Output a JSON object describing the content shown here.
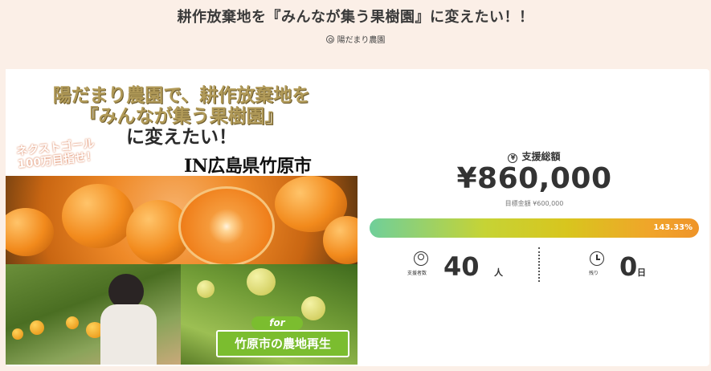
{
  "project": {
    "title": "耕作放棄地を『みんなが集う果樹園』に変えたい！！",
    "owner": "陽だまり農園"
  },
  "hero": {
    "headline_line1": "陽だまり農園で、耕作放棄地を",
    "headline_line2": "『みんなが集う果樹園』",
    "headline_line3": "に変えたい！",
    "stamp_line1": "ネクストゴール",
    "stamp_line2": "100万目指せ！",
    "location": "IN広島県竹原市",
    "for_tag": "for",
    "caption": "竹原市の農地再生"
  },
  "funding": {
    "label": "支援総額",
    "amount": "¥860,000",
    "goal": "目標金額 ¥600,000",
    "progress_percent": 143.33,
    "progress_text": "143.33%",
    "supporters_label": "支援者数",
    "supporters_count": "40",
    "supporters_unit": "人",
    "remaining_label": "残り",
    "remaining_count": "0",
    "remaining_unit": "日"
  },
  "colors": {
    "background": "#fbefe7",
    "accent_green": "#7bbd2f",
    "progress_start": "#6fcf9a",
    "progress_end": "#ef9429"
  },
  "icons": [
    "user-icon",
    "yen-icon",
    "supporters-icon",
    "clock-icon"
  ]
}
